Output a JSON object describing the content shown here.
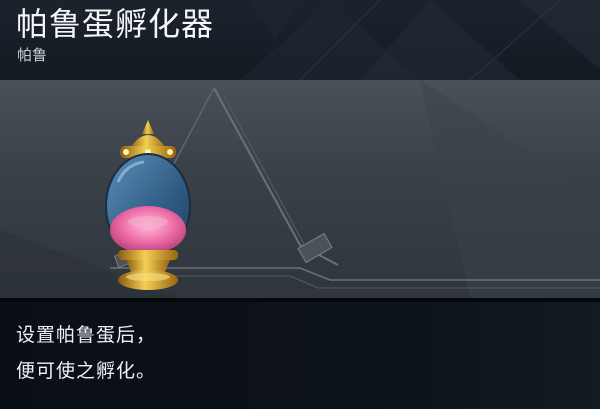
{
  "item": {
    "title": "帕鲁蛋孵化器",
    "category": "帕鲁"
  },
  "description": {
    "lines": [
      "设置帕鲁蛋后，",
      "便可使之孵化。"
    ]
  },
  "colors": {
    "header_bg": "#1a212b",
    "preview_bg": "#434950",
    "panel_bg": "#0b1016",
    "gold": "#d9a521",
    "glass_blue": "#3f6f9a",
    "egg_pink": "#ea6fa6"
  },
  "icons": {
    "item": "egg-incubator-icon"
  }
}
